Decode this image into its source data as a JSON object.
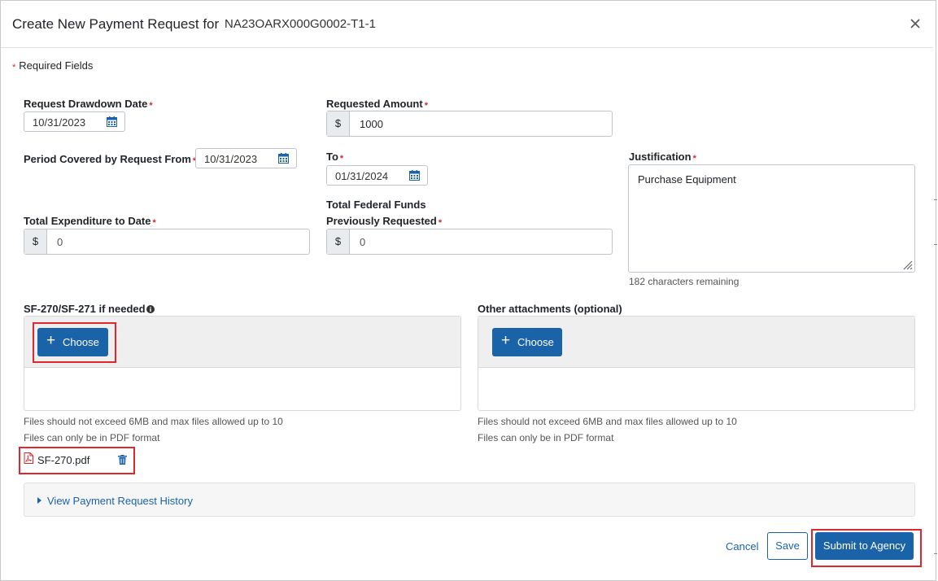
{
  "header": {
    "title": "Create New Payment Request for",
    "award_number": "NA23OARX000G0002-T1-1"
  },
  "required_note": "Required Fields",
  "required_marker": "*",
  "fields": {
    "request_drawdown_date": {
      "label": "Request Drawdown Date",
      "value": "10/31/2023"
    },
    "requested_amount": {
      "label": "Requested Amount",
      "prefix": "$",
      "value": "1000"
    },
    "period_from": {
      "label": "Period Covered by Request From",
      "value": "10/31/2023"
    },
    "period_to": {
      "label": "To",
      "value": "01/31/2024"
    },
    "justification": {
      "label": "Justification",
      "value": "Purchase Equipment",
      "remaining": "182 characters remaining"
    },
    "total_expenditure": {
      "label": "Total Expenditure to Date",
      "prefix": "$",
      "value": "0"
    },
    "total_federal_funds": {
      "label_line1": "Total Federal Funds",
      "label_line2": "Previously Requested",
      "prefix": "$",
      "value": "0"
    }
  },
  "attachments": {
    "sf": {
      "label": "SF-270/SF-271 if needed",
      "choose_label": "Choose",
      "hint_size": "Files should not exceed 6MB and max files allowed up to 10",
      "hint_format": "Files can only be in PDF format",
      "files": [
        "SF-270.pdf"
      ]
    },
    "other": {
      "label": "Other attachments (optional)",
      "choose_label": "Choose",
      "hint_size": "Files should not exceed 6MB and max files allowed up to 10",
      "hint_format": "Files can only be in PDF format"
    }
  },
  "history_link": "View Payment Request History",
  "footer": {
    "cancel_label": "Cancel",
    "save_label": "Save",
    "submit_label": "Submit to Agency"
  },
  "colors": {
    "primary": "#1b63a8",
    "required": "#d9262e",
    "highlight": "#e0262e"
  },
  "icons": [
    "close-icon",
    "calendar-icon",
    "info-icon",
    "plus-icon",
    "pdf-file-icon",
    "trash-icon",
    "caret-right-icon",
    "resize-handle-icon"
  ]
}
